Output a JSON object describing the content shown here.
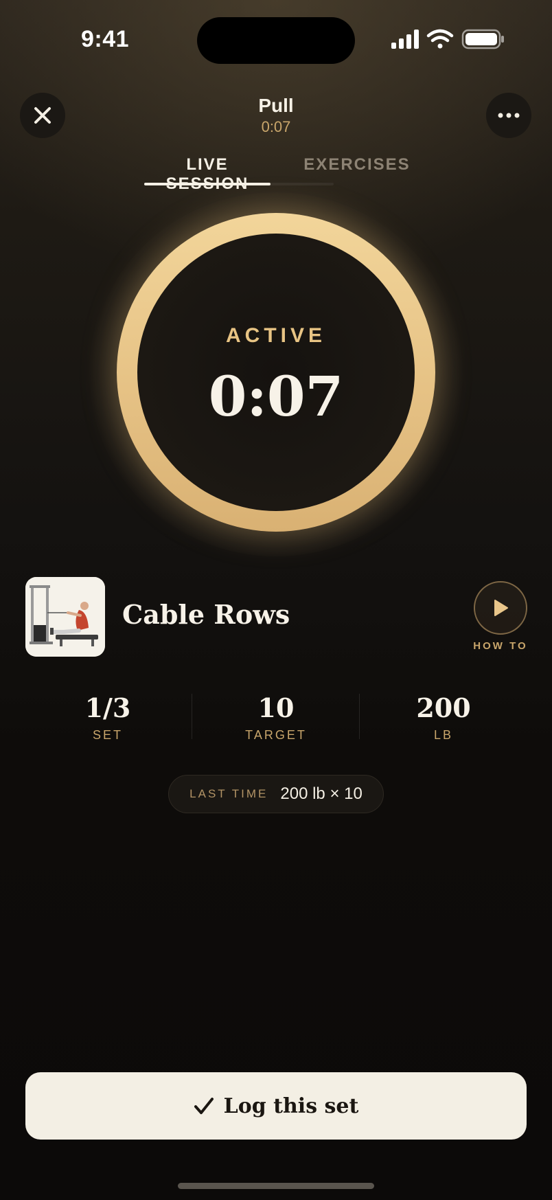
{
  "status_bar": {
    "time": "9:41",
    "icons": [
      "signal-icon",
      "wifi-icon",
      "battery-icon"
    ]
  },
  "header": {
    "title": "Pull",
    "elapsed": "0:07",
    "close_icon": "close-icon",
    "more_icon": "more-icon"
  },
  "tabs": [
    {
      "label": "LIVE SESSION",
      "active": true
    },
    {
      "label": "EXERCISES",
      "active": false
    }
  ],
  "timer": {
    "status": "ACTIVE",
    "time": "0:07",
    "ring_color": "#e6c285"
  },
  "exercise": {
    "name": "Cable Rows",
    "thumbnail_icon": "cable-row-illustration",
    "how_to_label": "HOW TO",
    "how_to_icon": "play-icon"
  },
  "stats": [
    {
      "value": "1/3",
      "label": "SET"
    },
    {
      "value": "10",
      "label": "TARGET"
    },
    {
      "value": "200",
      "label": "LB"
    }
  ],
  "last_time": {
    "label": "LAST TIME",
    "value": "200 lb × 10"
  },
  "log_button": {
    "icon": "checkmark-icon",
    "label": "Log this set"
  },
  "colors": {
    "accent": "#c9a66b",
    "ring": "#e6c285",
    "background": "#0d0b09",
    "button": "#f3efe4"
  }
}
